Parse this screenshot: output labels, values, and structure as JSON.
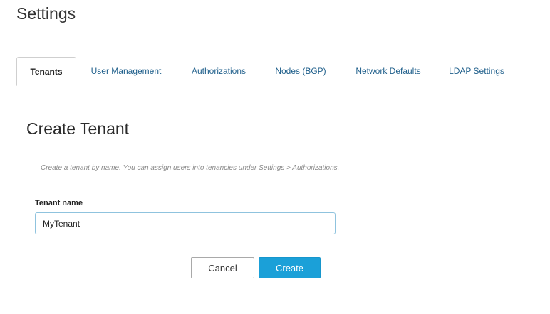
{
  "page": {
    "title": "Settings"
  },
  "tabs": [
    {
      "label": "Tenants",
      "active": true
    },
    {
      "label": "User Management",
      "active": false
    },
    {
      "label": "Authorizations",
      "active": false
    },
    {
      "label": "Nodes (BGP)",
      "active": false
    },
    {
      "label": "Network Defaults",
      "active": false
    },
    {
      "label": "LDAP Settings",
      "active": false
    }
  ],
  "form": {
    "heading": "Create Tenant",
    "help": "Create a tenant by name. You can assign users into tenancies under Settings > Authorizations.",
    "tenant_name_label": "Tenant name",
    "tenant_name_value": "MyTenant",
    "cancel_label": "Cancel",
    "create_label": "Create"
  },
  "colors": {
    "accent": "#1ba0d8",
    "link": "#1f5f8b",
    "input_border": "#8fc3de"
  }
}
